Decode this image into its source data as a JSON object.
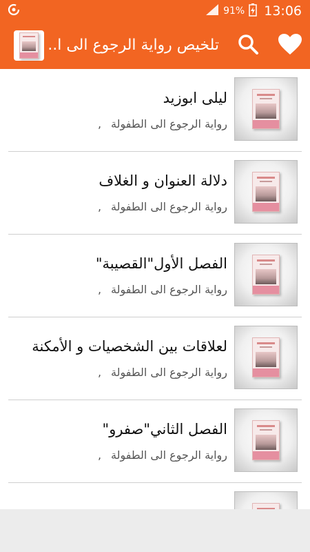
{
  "status_bar": {
    "battery_percent": "91%",
    "time": "13:06"
  },
  "app_bar": {
    "title": "تلخيص رواية الرجوع الى ا..."
  },
  "colors": {
    "accent": "#f26522"
  },
  "icons": {
    "search": "search-icon",
    "favorite": "heart-icon",
    "app_logo": "book-cover-icon"
  },
  "items": [
    {
      "title": "ليلى ابوزيد",
      "subtitle": "رواية الرجوع الى الطفولة",
      "separator": ","
    },
    {
      "title": "دلالة العنوان و الغلاف",
      "subtitle": "رواية الرجوع الى الطفولة",
      "separator": ","
    },
    {
      "title": "الفصل الأول\"القصيبة\"",
      "subtitle": "رواية الرجوع الى الطفولة",
      "separator": ","
    },
    {
      "title": "لعلاقات بين الشخصيات و الأمكنة",
      "subtitle": "رواية الرجوع الى الطفولة",
      "separator": ","
    },
    {
      "title": "الفصل الثاني\"صفرو\"",
      "subtitle": "رواية الرجوع الى الطفولة",
      "separator": ","
    },
    {
      "title": "",
      "subtitle": "",
      "separator": ""
    }
  ]
}
